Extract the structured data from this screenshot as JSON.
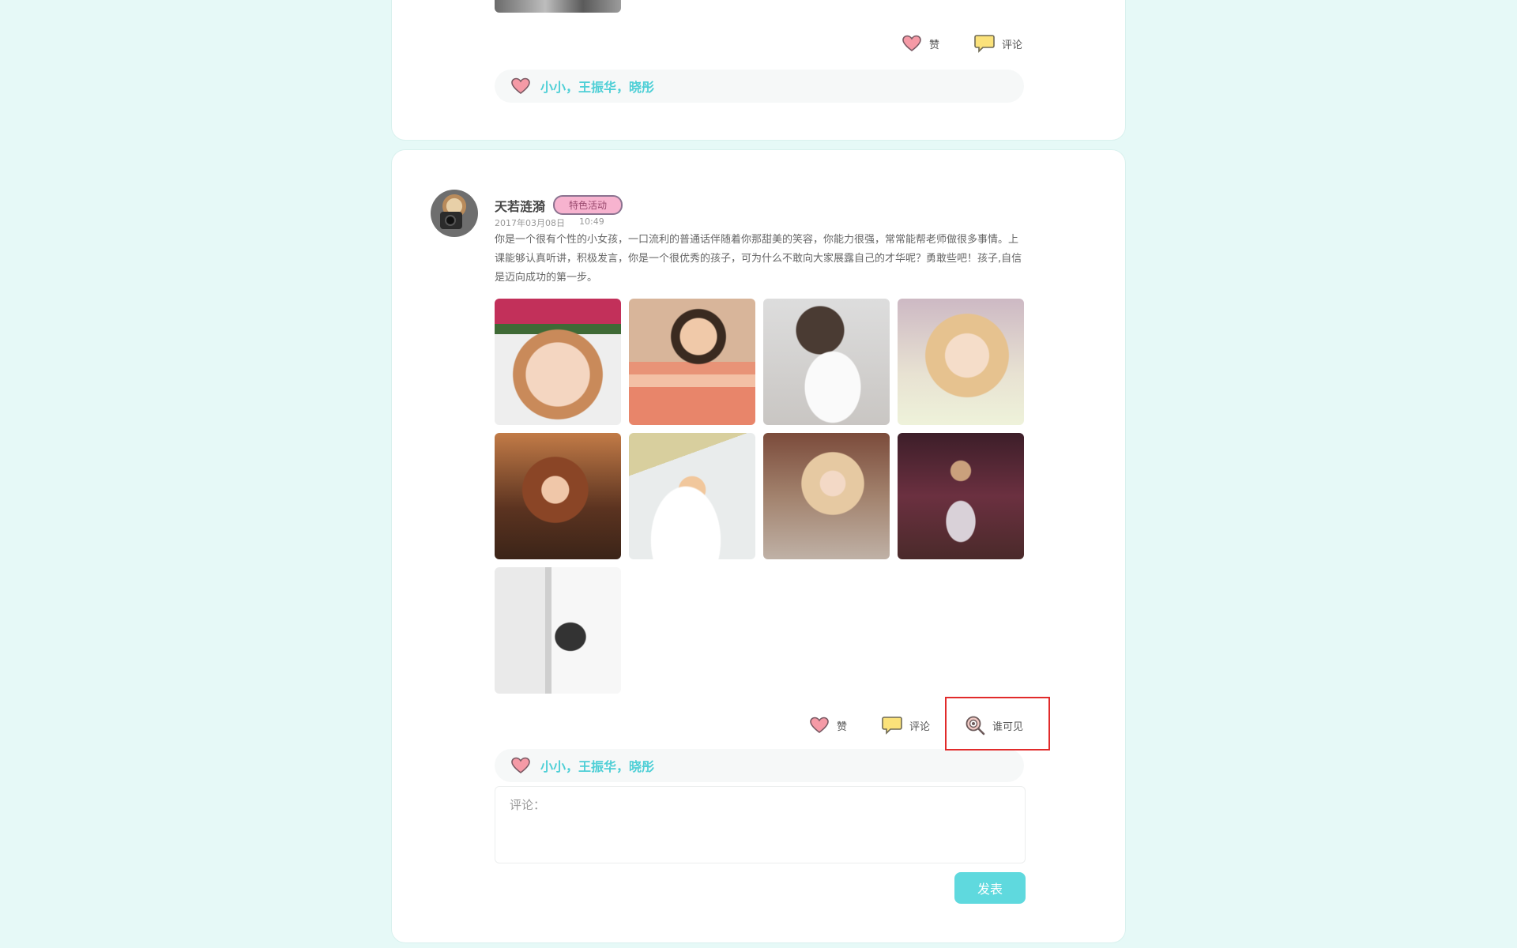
{
  "post_prev": {
    "actions": {
      "like_label": "赞",
      "comment_label": "评论"
    },
    "likes": {
      "names": "小小，王振华，晓彤"
    }
  },
  "post": {
    "user_name": "天若涟漪",
    "tag": "特色活动",
    "date": "2017年03月08日",
    "time": "10:49",
    "text": "你是一个很有个性的小女孩，一口流利的普通话伴随着你那甜美的笑容，你能力很强，常常能帮老师做很多事情。上课能够认真听讲，积极发言，你是一个很优秀的孩子，可为什么不敢向大家展露自己的才华呢？勇敢些吧！孩子,自信是迈向成功的第一步。",
    "photo_count": 9,
    "actions": {
      "like_label": "赞",
      "comment_label": "评论",
      "visibility_label": "谁可见"
    },
    "likes": {
      "names": "小小，王振华，晓彤"
    },
    "comment": {
      "placeholder": "评论："
    },
    "submit_label": "发表"
  },
  "colors": {
    "background": "#e6f9f7",
    "accent": "#5fd9de",
    "like_names": "#4ecfd6",
    "tag_bg": "#f7b3cf",
    "highlight_border": "#e12b2b"
  },
  "icons": {
    "like": "heart-icon",
    "comment": "speech-bubble-icon",
    "visibility": "eye-magnifier-icon"
  }
}
